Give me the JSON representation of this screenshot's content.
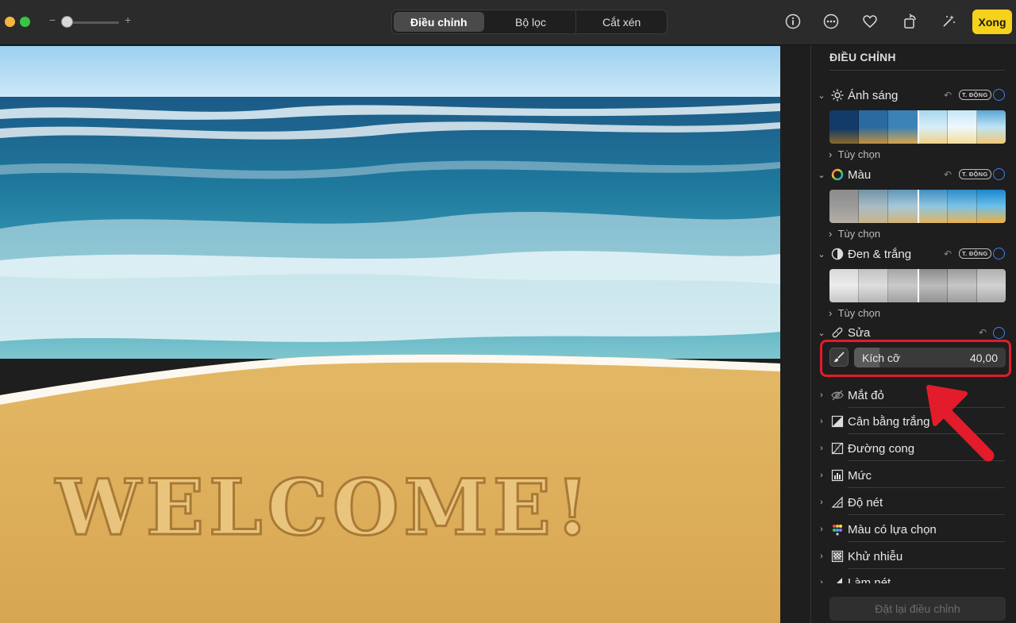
{
  "toolbar": {
    "zoom_minus": "−",
    "zoom_plus": "+",
    "tabs": [
      {
        "label": "Điều chỉnh",
        "active": true
      },
      {
        "label": "Bộ lọc",
        "active": false
      },
      {
        "label": "Cắt xén",
        "active": false
      }
    ],
    "icons": [
      "info-icon",
      "more-icon",
      "heart-icon",
      "rotate-icon",
      "magic-wand-icon"
    ],
    "done_label": "Xong"
  },
  "photo": {
    "text_in_sand": "WELCOME!",
    "description_icon": "beach-photo"
  },
  "sidebar": {
    "title": "ĐIỀU CHỈNH",
    "auto_badge": "T. ĐỘNG",
    "options_label": "Tùy chọn",
    "sections_expanded": [
      {
        "label": "Ánh sáng",
        "icon": "sun-icon"
      },
      {
        "label": "Màu",
        "icon": "color-wheel-icon"
      },
      {
        "label": "Đen & trắng",
        "icon": "half-circle-icon"
      }
    ],
    "retouch": {
      "label": "Sửa",
      "icon": "bandage-icon",
      "size_label": "Kích cỡ",
      "size_value": "40,00",
      "size_fraction": 0.17
    },
    "sections_collapsed": [
      {
        "label": "Mắt đỏ",
        "icon": "eye-icon"
      },
      {
        "label": "Cân bằng trắng",
        "icon": "white-balance-icon"
      },
      {
        "label": "Đường cong",
        "icon": "curves-icon"
      },
      {
        "label": "Mức",
        "icon": "levels-icon"
      },
      {
        "label": "Độ nét",
        "icon": "definition-icon"
      },
      {
        "label": "Màu có lựa chọn",
        "icon": "selective-color-icon"
      },
      {
        "label": "Khử nhiễu",
        "icon": "noise-reduction-icon"
      },
      {
        "label": "Làm nét",
        "icon": "sharpen-icon"
      }
    ],
    "reset_label": "Đặt lại điều chỉnh"
  },
  "colors": {
    "done_button": "#f6d21c",
    "highlight": "#e21c2a",
    "toggle": "#3b82f6"
  }
}
